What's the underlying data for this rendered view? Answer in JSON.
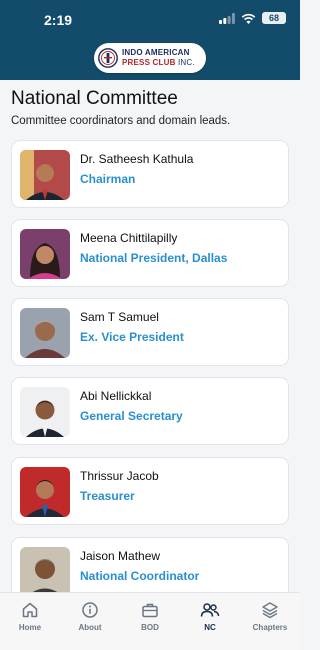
{
  "status_bar": {
    "time": "2:19",
    "battery": "68"
  },
  "brand": {
    "line1": "INDO AMERICAN",
    "line2_bold": "PRESS CLUB",
    "line2_rest": " INC."
  },
  "page": {
    "title": "National Committee",
    "subtitle": "Committee coordinators and domain leads."
  },
  "members": [
    {
      "name": "Dr. Satheesh Kathula",
      "role": "Chairman"
    },
    {
      "name": "Meena Chittilapilly",
      "role": "National President, Dallas"
    },
    {
      "name": "Sam T Samuel",
      "role": "Ex. Vice President"
    },
    {
      "name": "Abi Nellickkal",
      "role": "General Secretary"
    },
    {
      "name": "Thrissur Jacob",
      "role": "Treasurer"
    },
    {
      "name": "Jaison Mathew",
      "role": "National Coordinator"
    }
  ],
  "tabs": [
    {
      "label": "Home",
      "icon": "home-icon"
    },
    {
      "label": "About",
      "icon": "info-icon"
    },
    {
      "label": "BOD",
      "icon": "briefcase-icon"
    },
    {
      "label": "NC",
      "icon": "people-icon",
      "active": true
    },
    {
      "label": "Chapters",
      "icon": "layers-icon"
    }
  ],
  "colors": {
    "header": "#134b6b",
    "role_text": "#2a8fd0",
    "active_tab": "#1a2d45"
  }
}
